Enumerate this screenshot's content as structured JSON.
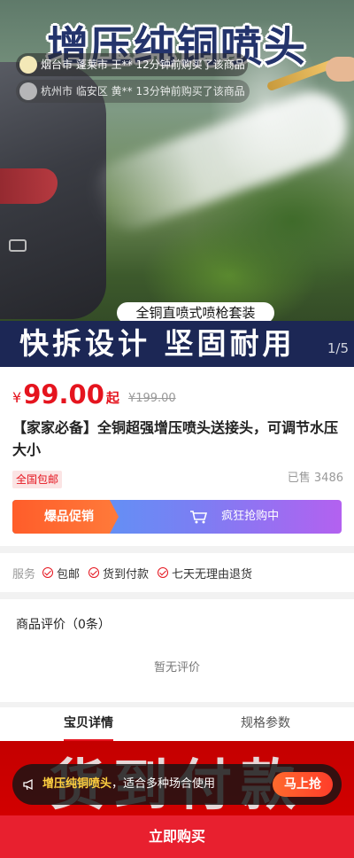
{
  "hero": {
    "title": "增压纯铜喷头",
    "tickers": [
      {
        "text": "烟台市 蓬莱市 王** 12分钟前购买了该商品"
      },
      {
        "text": "杭州市 临安区 黄** 13分钟前购买了该商品"
      }
    ],
    "subcaption": "全铜直喷式喷枪套装",
    "bottom_text": "快拆设计 坚固耐用",
    "pager": "1/5"
  },
  "product": {
    "currency": "¥",
    "price": "99.00",
    "price_suffix": "起",
    "original_price": "¥199.00",
    "title": "【家家必备】全铜超强增压喷头送接头，可调节水压大小",
    "shipping_tag": "全国包邮",
    "sold": "已售 3486"
  },
  "promo": {
    "left_label": "爆品促销",
    "right_label": "疯狂抢购中",
    "cart_icon": "cart-icon"
  },
  "service": {
    "label": "服务",
    "items": [
      "包邮",
      "货到付款",
      "七天无理由退货"
    ]
  },
  "reviews": {
    "heading": "商品评价（0条）",
    "empty_text": "暂无评价"
  },
  "tabs": [
    "宝贝详情",
    "规格参数"
  ],
  "detail": {
    "banner_text": "货到付款"
  },
  "float_bar": {
    "highlight": "增压纯铜喷头",
    "text": "，适合多种场合使用",
    "button": "马上抢"
  },
  "buy_button": "立即购买",
  "colors": {
    "accent": "#e5141e",
    "buy": "#e8202f",
    "promo_orange": "#ff5d2a",
    "hero_band": "#1c2755"
  }
}
